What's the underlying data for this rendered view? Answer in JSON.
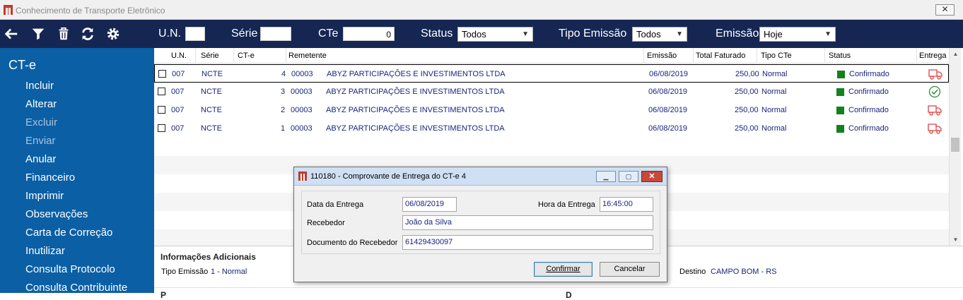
{
  "window": {
    "title": "Conhecimento de Transporte Eletrônico",
    "ghost_label": "Tipo Emissão",
    "close_glyph": "✕"
  },
  "toolbar": {
    "icons": [
      "back-arrow-icon",
      "filter-icon",
      "trash-icon",
      "refresh-icon",
      "gear-icon"
    ],
    "un_label": "U.N.",
    "un_value": "",
    "serie_label": "Série",
    "serie_value": "",
    "cte_label": "CTe",
    "cte_value": "0",
    "status_label": "Status",
    "status_value": "Todos",
    "tipo_emissao_label": "Tipo Emissão",
    "tipo_emissao_value": "Todos",
    "emissao_label": "Emissão",
    "emissao_value": "Hoje",
    "bg_color": "#162653"
  },
  "sidebar": {
    "title": "CT-e",
    "bg_color": "#0b5fa5",
    "items": [
      {
        "label": "Incluir",
        "enabled": true
      },
      {
        "label": "Alterar",
        "enabled": true
      },
      {
        "label": "Excluir",
        "enabled": false
      },
      {
        "label": "Enviar",
        "enabled": false
      },
      {
        "label": "Anular",
        "enabled": true
      },
      {
        "label": "Financeiro",
        "enabled": true
      },
      {
        "label": "Imprimir",
        "enabled": true
      },
      {
        "label": "Observações",
        "enabled": true
      },
      {
        "label": "Carta de Correção",
        "enabled": true
      },
      {
        "label": "Inutilizar",
        "enabled": true
      },
      {
        "label": "Consulta Protocolo",
        "enabled": true
      },
      {
        "label": "Consulta Contribuinte",
        "enabled": true
      }
    ]
  },
  "grid": {
    "headers": {
      "un": "U.N.",
      "serie": "Série",
      "cte": "CT-e",
      "remetente": "Remetente",
      "emissao": "Emissão",
      "total": "Total Faturado",
      "tipo": "Tipo CTe",
      "status": "Status",
      "entrega": "Entrega"
    },
    "rows": [
      {
        "un": "007",
        "serie": "NCTE",
        "cte": "4",
        "code": "00003",
        "remetente": "ABYZ PARTICIPAÇÕES E INVESTIMENTOS LTDA",
        "emissao": "06/08/2019",
        "total": "250,00",
        "tipo": "Normal",
        "status": "Confirmado",
        "entrega": "truck-icon",
        "selected": true
      },
      {
        "un": "007",
        "serie": "NCTE",
        "cte": "3",
        "code": "00003",
        "remetente": "ABYZ PARTICIPAÇÕES E INVESTIMENTOS LTDA",
        "emissao": "06/08/2019",
        "total": "250,00",
        "tipo": "Normal",
        "status": "Confirmado",
        "entrega": "check-circle-icon",
        "selected": false
      },
      {
        "un": "007",
        "serie": "NCTE",
        "cte": "2",
        "code": "00003",
        "remetente": "ABYZ PARTICIPAÇÕES E INVESTIMENTOS LTDA",
        "emissao": "06/08/2019",
        "total": "250,00",
        "tipo": "Normal",
        "status": "Confirmado",
        "entrega": "truck-icon",
        "selected": false
      },
      {
        "un": "007",
        "serie": "NCTE",
        "cte": "1",
        "code": "00003",
        "remetente": "ABYZ PARTICIPAÇÕES E INVESTIMENTOS LTDA",
        "emissao": "06/08/2019",
        "total": "250,00",
        "tipo": "Normal",
        "status": "Confirmado",
        "entrega": "truck-icon",
        "selected": false
      }
    ],
    "status_color": "#15801e",
    "truck_color": "#e04040",
    "check_color": "#2e8b3a"
  },
  "info": {
    "title": "Informações Adicionais",
    "tipo_emissao_label": "Tipo Emissão",
    "tipo_emissao_value": "1 - Normal",
    "destino_label": "Destino",
    "destino_value": "CAMPO BOM - RS",
    "footer_left": "P",
    "footer_right": "D"
  },
  "modal": {
    "title": "110180 - Comprovante de Entrega do CT-e 4",
    "data_label": "Data da Entrega",
    "data_value": "06/08/2019",
    "hora_label": "Hora da Entrega",
    "hora_value": "16:45:00",
    "recebedor_label": "Recebedor",
    "recebedor_value": "João da Silva",
    "documento_label": "Documento do Recebedor",
    "documento_value": "61429430097",
    "confirm_label": "Confirmar",
    "cancel_label": "Cancelar"
  }
}
